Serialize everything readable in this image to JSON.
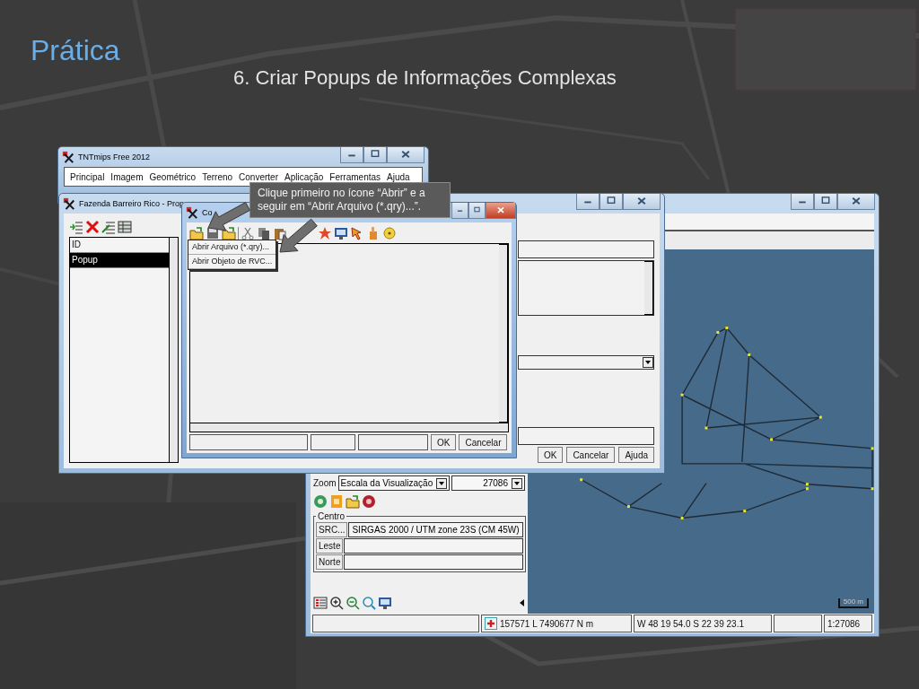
{
  "slide": {
    "title": "Prática",
    "subtitle": "6. Criar Popups de Informações Complexas"
  },
  "main_window": {
    "title": "TNTmips Free 2012",
    "menu": [
      "Principal",
      "Imagem",
      "Geométrico",
      "Terreno",
      "Converter",
      "Aplicação",
      "Ferramentas",
      "Ajuda"
    ]
  },
  "map_window": {
    "zoom_label": "Zoom",
    "zoom_mode": "Escala da Visualização",
    "scale_value": "27086",
    "group_label": "Centro",
    "fields": [
      {
        "label": "SRC...",
        "value": "SIRGAS 2000 / UTM zone 23S (CM 45W)"
      },
      {
        "label": "Leste"
      },
      {
        "label": "Norte"
      }
    ],
    "scale_bar": "500 m",
    "status_bar": [
      "157571 L 7490677 N m",
      "W 48 19 54.0 S 22 39 23.1",
      "1:27086"
    ]
  },
  "property_window": {
    "title": "Fazenda Barreiro Rico - Prop",
    "list": [
      {
        "label": "ID",
        "selected": false
      },
      {
        "label": "Popup",
        "selected": true
      }
    ],
    "buttons": [
      "OK",
      "Cancelar",
      "Ajuda"
    ]
  },
  "query_dialog": {
    "title": "Co",
    "menu": [
      "Abrir Arquivo (*.qry)...",
      "Abrir Objeto de RVC..."
    ],
    "buttons": [
      "OK",
      "Cancelar"
    ]
  },
  "callout": {
    "text": "Clique primeiro no ícone “Abrir” e a seguir em “Abrir Arquivo (*.qry)...”."
  }
}
